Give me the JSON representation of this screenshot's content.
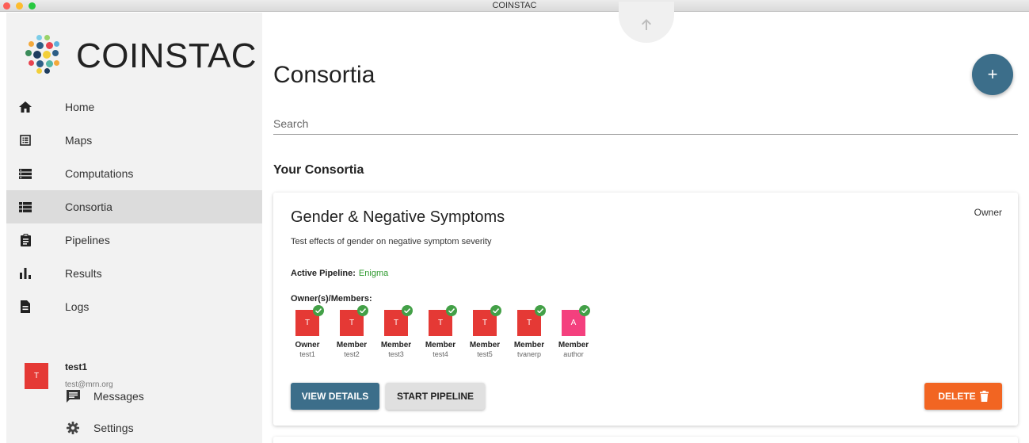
{
  "window": {
    "title": "COINSTAC"
  },
  "sidebar": {
    "brand": "COINSTAC",
    "items": [
      {
        "label": "Home",
        "icon": "home-icon"
      },
      {
        "label": "Maps",
        "icon": "maps-icon"
      },
      {
        "label": "Computations",
        "icon": "computations-icon"
      },
      {
        "label": "Consortia",
        "icon": "consortia-icon",
        "active": true
      },
      {
        "label": "Pipelines",
        "icon": "pipelines-icon"
      },
      {
        "label": "Results",
        "icon": "results-icon"
      },
      {
        "label": "Logs",
        "icon": "logs-icon"
      }
    ],
    "user": {
      "initial": "T",
      "name": "test1",
      "email": "test@mrn.org"
    },
    "sub_items": [
      {
        "label": "Messages",
        "icon": "message-icon"
      },
      {
        "label": "Settings",
        "icon": "gear-icon"
      }
    ]
  },
  "main": {
    "title": "Consortia",
    "add_button": "+",
    "search": {
      "placeholder": "Search",
      "value": ""
    },
    "section_title": "Your Consortia",
    "consortium": {
      "title": "Gender & Negative Symptoms",
      "role": "Owner",
      "description": "Test effects of gender on negative symptom severity",
      "active_pipeline_label": "Active Pipeline:",
      "active_pipeline": "Enigma",
      "members_label": "Owner(s)/Members:",
      "members": [
        {
          "initial": "T",
          "role": "Owner",
          "user": "test1",
          "color": "#e53935"
        },
        {
          "initial": "T",
          "role": "Member",
          "user": "test2",
          "color": "#e53935"
        },
        {
          "initial": "T",
          "role": "Member",
          "user": "test3",
          "color": "#e53935"
        },
        {
          "initial": "T",
          "role": "Member",
          "user": "test4",
          "color": "#e53935"
        },
        {
          "initial": "T",
          "role": "Member",
          "user": "test5",
          "color": "#e53935"
        },
        {
          "initial": "T",
          "role": "Member",
          "user": "tvanerp",
          "color": "#e53935"
        },
        {
          "initial": "A",
          "role": "Member",
          "user": "author",
          "color": "#f4407e"
        }
      ],
      "buttons": {
        "view": "VIEW DETAILS",
        "start": "START PIPELINE",
        "delete": "DELETE"
      }
    }
  },
  "colors": {
    "primary": "#3c6e8a",
    "danger": "#f26522",
    "success": "#43a047",
    "avatar_red": "#e53935",
    "avatar_pink": "#f4407e"
  }
}
